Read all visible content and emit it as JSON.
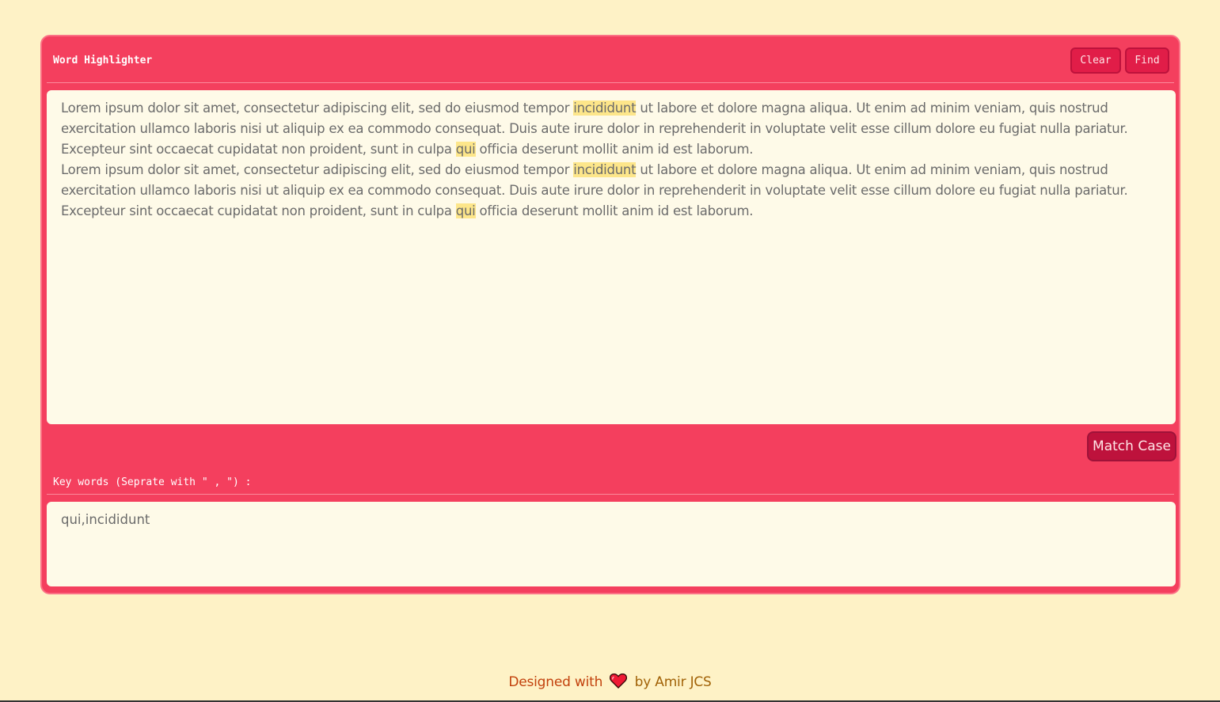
{
  "header": {
    "title": "Word Highlighter",
    "clear_label": "Clear",
    "find_label": "Find"
  },
  "text_area": {
    "paragraphs": [
      "Lorem ipsum dolor sit amet, consectetur adipiscing elit, sed do eiusmod tempor incididunt ut labore et dolore magna aliqua. Ut enim ad minim veniam, quis nostrud exercitation ullamco laboris nisi ut aliquip ex ea commodo consequat. Duis aute irure dolor in reprehenderit in voluptate velit esse cillum dolore eu fugiat nulla pariatur. Excepteur sint occaecat cupidatat non proident, sunt in culpa qui officia deserunt mollit anim id est laborum.",
      "Lorem ipsum dolor sit amet, consectetur adipiscing elit, sed do eiusmod tempor incididunt ut labore et dolore magna aliqua. Ut enim ad minim veniam, quis nostrud exercitation ullamco laboris nisi ut aliquip ex ea commodo consequat. Duis aute irure dolor in reprehenderit in voluptate velit esse cillum dolore eu fugiat nulla pariatur. Excepteur sint occaecat cupidatat non proident, sunt in culpa qui officia deserunt mollit anim id est laborum."
    ],
    "highlighted_words": [
      "qui",
      "incididunt"
    ],
    "highlight_color": "#fde68a"
  },
  "options": {
    "match_case_label": "Match Case"
  },
  "keywords": {
    "label": "Key words (Seprate with \" , \") :",
    "value": "qui,incididunt"
  },
  "footer": {
    "prefix": "Designed with",
    "icon": "heart-icon",
    "suffix": "by Amir JCS"
  },
  "colors": {
    "background": "#fef2c6",
    "panel": "#f43f5e",
    "button": "#e11d48",
    "button_dark": "#be123c",
    "editor_bg": "#fefae8",
    "footer_text": "#c2410c"
  }
}
